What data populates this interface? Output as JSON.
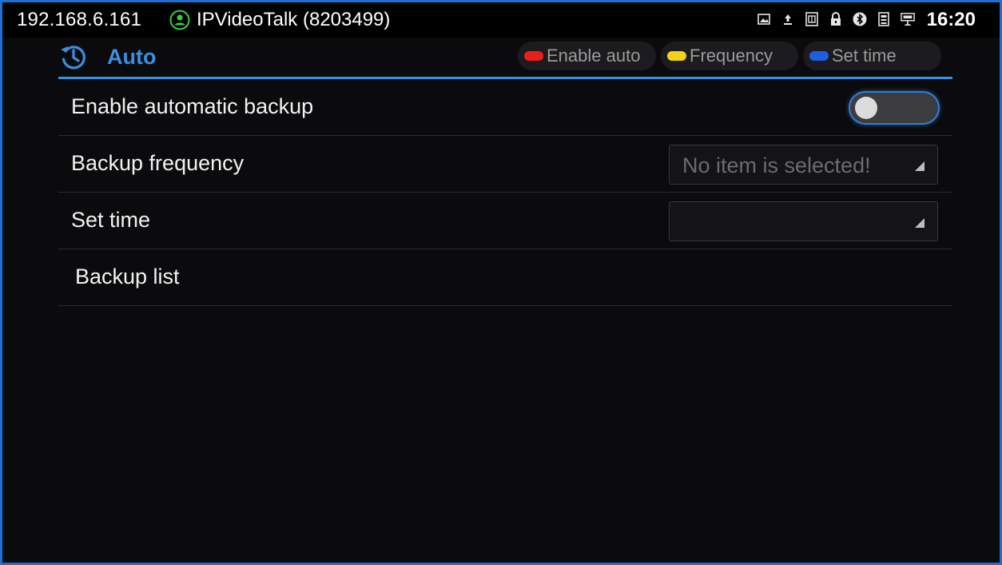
{
  "status_bar": {
    "ip": "192.168.6.161",
    "app_name": "IPVideoTalk (8203499)",
    "time": "16:20",
    "icons": [
      "image-icon",
      "upload-icon",
      "sim-icon",
      "lock-icon",
      "bluetooth-icon",
      "storage-icon",
      "ethernet-icon"
    ]
  },
  "header": {
    "title": "Auto",
    "icon": "history-icon",
    "accent_color": "#3a8fe0",
    "legend": [
      {
        "label": "Enable auto",
        "color": "#e8201c"
      },
      {
        "label": "Frequency",
        "color": "#f2d31a"
      },
      {
        "label": "Set time",
        "color": "#1e5fe0"
      }
    ]
  },
  "settings": {
    "enable_backup": {
      "label": "Enable automatic backup",
      "enabled": false
    },
    "frequency": {
      "label": "Backup frequency",
      "value": "No item is selected!"
    },
    "set_time": {
      "label": "Set time",
      "value": ""
    },
    "backup_list": {
      "label": "Backup list"
    }
  }
}
